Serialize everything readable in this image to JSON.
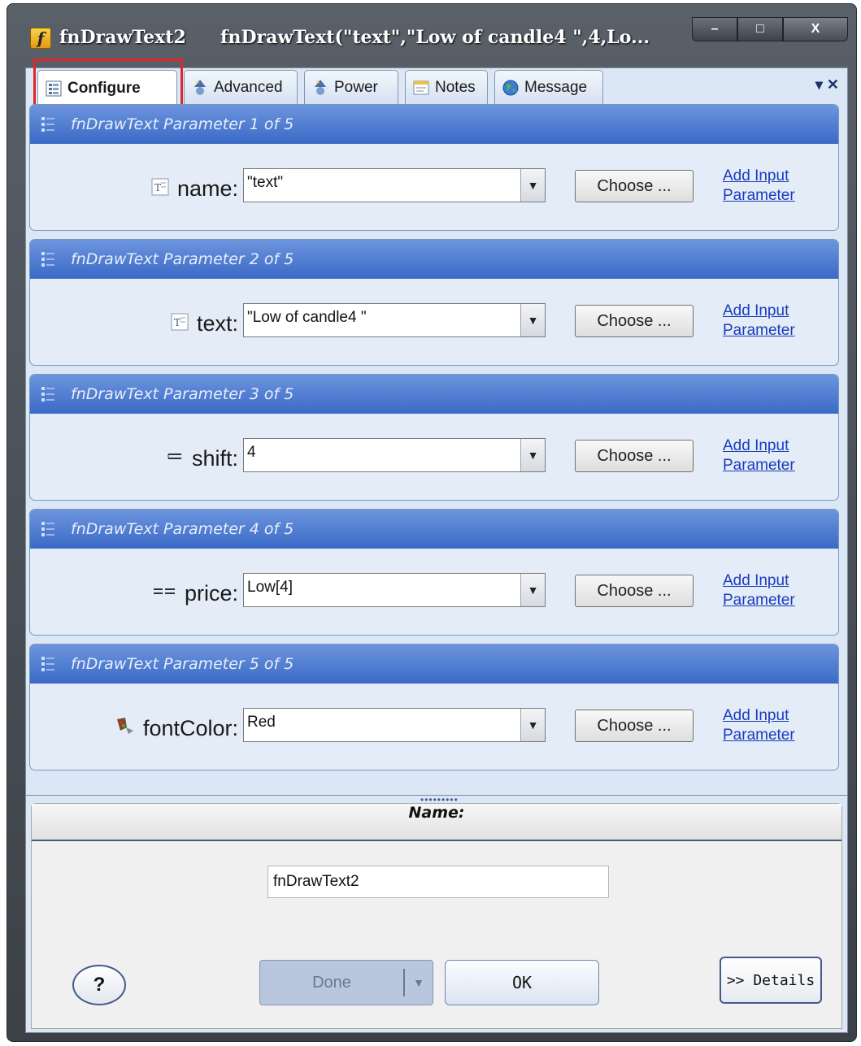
{
  "window": {
    "logo": "f",
    "title": "fnDrawText2",
    "expression": "fnDrawText(\"text\",\"Low of candle4 \",4,Lo...",
    "controls": {
      "minimize": "–",
      "maximize": "□",
      "close": "X"
    }
  },
  "tabs": [
    {
      "label": "Configure",
      "icon": "configure-icon"
    },
    {
      "label": "Advanced",
      "icon": "wizard-icon"
    },
    {
      "label": "Power",
      "icon": "wizard-icon"
    },
    {
      "label": "Notes",
      "icon": "notes-icon"
    },
    {
      "label": "Message",
      "icon": "globe-icon"
    }
  ],
  "tab_extras": {
    "dropdown": "▾",
    "close": "✕"
  },
  "params": [
    {
      "header": "fnDrawText Parameter 1 of 5",
      "label": "name:",
      "value": "\"text\"",
      "icon": "text-type-icon"
    },
    {
      "header": "fnDrawText Parameter 2 of 5",
      "label": "text:",
      "value": "\"Low of candle4 \"",
      "icon": "text-type-icon"
    },
    {
      "header": "fnDrawText Parameter 3 of 5",
      "label": "shift:",
      "value": "4",
      "icon": "integer-type-icon"
    },
    {
      "header": "fnDrawText Parameter 4 of 5",
      "label": "price:",
      "value": "Low[4]",
      "icon": "double-type-icon"
    },
    {
      "header": "fnDrawText Parameter 5 of 5",
      "label": "fontColor:",
      "value": "Red",
      "icon": "color-type-icon"
    }
  ],
  "common": {
    "choose_label": "Choose ...",
    "add_input_line1": "Add Input",
    "add_input_line2": "Parameter",
    "combo_arrow": "▼"
  },
  "name_panel": {
    "header": "Name:",
    "value": "fnDrawText2"
  },
  "buttons": {
    "help": "?",
    "done": "Done",
    "done_arrow": "▼",
    "ok": "OK",
    "details": ">> Details"
  },
  "colors": {
    "highlight": "#e0262a",
    "group_header": "#3a6ac6",
    "link": "#1a3cbe"
  }
}
